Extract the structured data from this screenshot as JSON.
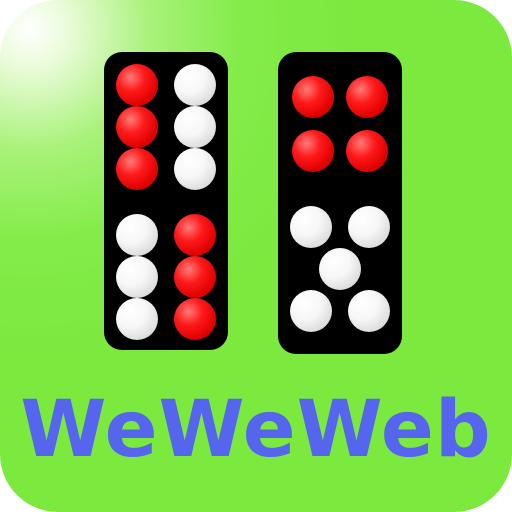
{
  "brand": {
    "name": "WeWeWeb",
    "text_color": "#5565ee",
    "background_color": "#7ce93f"
  },
  "tiles": [
    {
      "id": "left",
      "pip_colors": {
        "red": "#e00000",
        "white": "#f2f2f2"
      }
    },
    {
      "id": "right",
      "pip_colors": {
        "red": "#e00000",
        "white": "#f2f2f2"
      }
    }
  ]
}
